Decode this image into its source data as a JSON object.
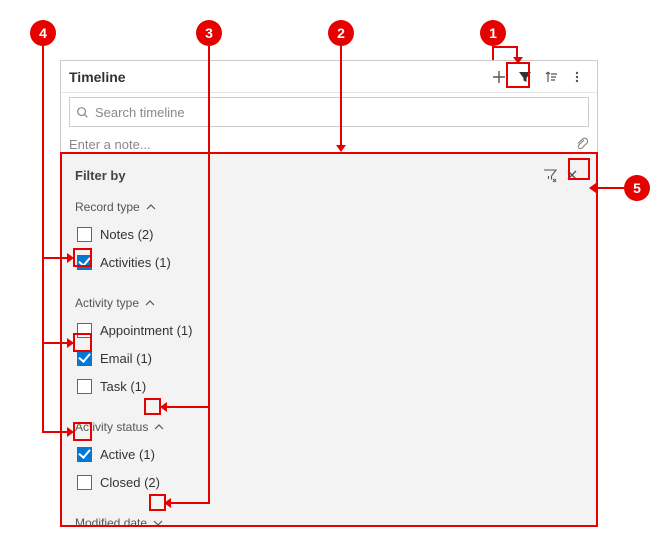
{
  "header": {
    "title": "Timeline"
  },
  "search": {
    "placeholder": "Search timeline"
  },
  "note": {
    "placeholder": "Enter a note..."
  },
  "filter": {
    "title": "Filter by",
    "groups": {
      "recordType": {
        "label": "Record type",
        "options": {
          "notes": "Notes (2)",
          "activities": "Activities (1)"
        }
      },
      "activityType": {
        "label": "Activity type",
        "options": {
          "appointment": "Appointment (1)",
          "email": "Email (1)",
          "task": "Task (1)"
        }
      },
      "activityStatus": {
        "label": "Activity status",
        "options": {
          "active": "Active (1)",
          "closed": "Closed (2)"
        }
      },
      "modifiedDate": {
        "label": "Modified date"
      }
    }
  },
  "icons": {
    "add": "add-icon",
    "filter": "filter-icon",
    "sort": "sort-icon",
    "more": "more-icon",
    "search": "search-icon",
    "attach": "attach-icon",
    "clearFilter": "clear-filter-icon",
    "close": "close-icon",
    "caretUp": "chevron-up-icon",
    "caretDown": "chevron-down-icon"
  },
  "annotations": {
    "b1": "1",
    "b2": "2",
    "b3": "3",
    "b4": "4",
    "b5": "5"
  },
  "colors": {
    "annotation": "#e60000",
    "checkbox_checked": "#0078d4"
  }
}
